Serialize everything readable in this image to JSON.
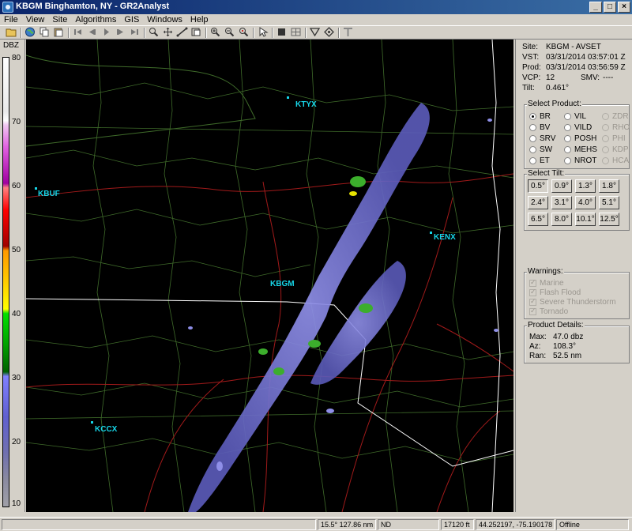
{
  "window": {
    "title": "KBGM Binghamton, NY - GR2Analyst",
    "minimize": "_",
    "maximize": "□",
    "close": "×"
  },
  "menu": [
    "File",
    "View",
    "Site",
    "Algorithms",
    "GIS",
    "Windows",
    "Help"
  ],
  "toolbar": {
    "icons": [
      "open-folder-icon",
      "globe-icon",
      "copy-icon",
      "paste-icon",
      "skip-first-icon",
      "step-back-icon",
      "play-icon",
      "step-forward-icon",
      "skip-last-icon",
      "zoom-icon",
      "pan-icon",
      "measure-icon",
      "link-icon",
      "layers-icon",
      "zoom-in-icon",
      "zoom-out-icon",
      "zoom-reset-icon",
      "cursor-icon",
      "stop-icon",
      "grid-icon",
      "filter-icon",
      "diamond-icon",
      "text-icon"
    ]
  },
  "scale": {
    "unit": "DBZ",
    "ticks": [
      "80",
      "70",
      "60",
      "50",
      "40",
      "30",
      "20",
      "10"
    ]
  },
  "map": {
    "sites": [
      {
        "name": "KTYX"
      },
      {
        "name": "KBUF"
      },
      {
        "name": "KENX"
      },
      {
        "name": "KBGM"
      },
      {
        "name": "KCCX"
      }
    ]
  },
  "info": {
    "site_label": "Site:",
    "site_value": "KBGM - AVSET",
    "vst_label": "VST:",
    "vst_value": "03/31/2014  03:57:01 Z",
    "prod_label": "Prod:",
    "prod_value": "03/31/2014  03:56:59 Z",
    "vcp_label": "VCP:",
    "vcp_value": "12",
    "smv_label": "SMV:",
    "smv_value": "----",
    "tilt_label": "Tilt:",
    "tilt_value": "0.461°"
  },
  "select_product": {
    "title": "Select Product:",
    "options": [
      {
        "label": "BR",
        "selected": true,
        "enabled": true
      },
      {
        "label": "VIL",
        "selected": false,
        "enabled": true
      },
      {
        "label": "ZDR",
        "selected": false,
        "enabled": false
      },
      {
        "label": "BV",
        "selected": false,
        "enabled": true
      },
      {
        "label": "VILD",
        "selected": false,
        "enabled": true
      },
      {
        "label": "RHO",
        "selected": false,
        "enabled": false
      },
      {
        "label": "SRV",
        "selected": false,
        "enabled": true
      },
      {
        "label": "POSH",
        "selected": false,
        "enabled": true
      },
      {
        "label": "PHI",
        "selected": false,
        "enabled": false
      },
      {
        "label": "SW",
        "selected": false,
        "enabled": true
      },
      {
        "label": "MEHS",
        "selected": false,
        "enabled": true
      },
      {
        "label": "KDP",
        "selected": false,
        "enabled": false
      },
      {
        "label": "ET",
        "selected": false,
        "enabled": true
      },
      {
        "label": "NROT",
        "selected": false,
        "enabled": true
      },
      {
        "label": "HCA",
        "selected": false,
        "enabled": false
      }
    ]
  },
  "select_tilt": {
    "title": "Select Tilt:",
    "tilts": [
      "0.5°",
      "0.9°",
      "1.3°",
      "1.8°",
      "2.4°",
      "3.1°",
      "4.0°",
      "5.1°",
      "6.5°",
      "8.0°",
      "10.1°",
      "12.5°"
    ],
    "active": "0.5°"
  },
  "warnings": {
    "title": "Warnings:",
    "items": [
      "Marine",
      "Flash Flood",
      "Severe Thunderstorm",
      "Tornado"
    ]
  },
  "product_details": {
    "title": "Product Details:",
    "max_label": "Max:",
    "max_value": "47.0 dbz",
    "az_label": "Az:",
    "az_value": "108.3°",
    "ran_label": "Ran:",
    "ran_value": "52.5 nm"
  },
  "status": {
    "cell1": "",
    "cell2": "15.5° 127.86 nm",
    "cell3": "ND",
    "cell4": "17120 ft",
    "cell5": "44.252197, -75.190178",
    "cell6": "Offline"
  }
}
